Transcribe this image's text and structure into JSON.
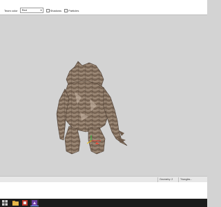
{
  "toolbar": {
    "team_label": "Team color",
    "team_value": "Red",
    "shadows_label": "Shadows",
    "particles_label": "Particles",
    "shadows_checked": false,
    "particles_checked": false
  },
  "statusbar": {
    "pane1": "Geometry: 2",
    "pane2": "Triangles..."
  },
  "taskbar": {
    "tray_time": "",
    "tray_date": ""
  },
  "colors": {
    "viewport_bg": "#d3d3d3",
    "taskbar_bg": "#1b1b1b",
    "start_accent": "#2f6fd6",
    "app_icon_red": "#c0392b",
    "app_icon_purple": "#6a3ea1"
  },
  "icons": [
    "windows-start-icon",
    "file-explorer-icon",
    "app-icon",
    "app-icon-2"
  ]
}
